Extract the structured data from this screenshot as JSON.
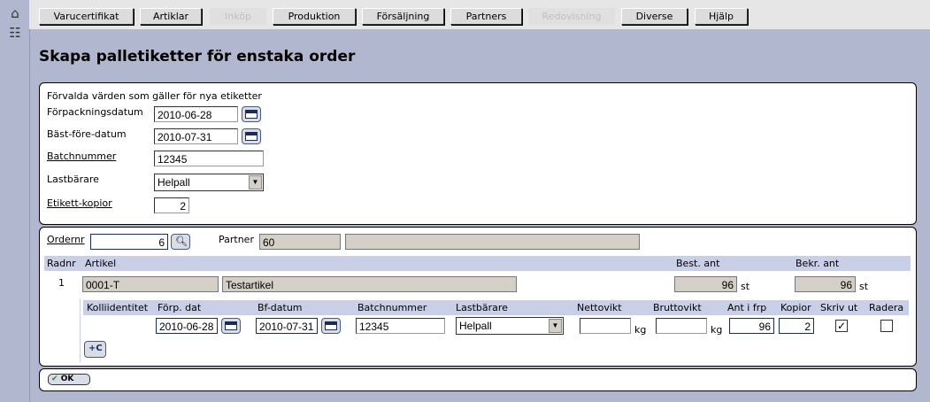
{
  "nav": {
    "menu": [
      "Varucertifikat",
      "Artiklar",
      "Inköp",
      "Produktion",
      "Försäljning",
      "Partners",
      "Redovisning",
      "Diverse",
      "Hjälp"
    ]
  },
  "page": {
    "title": "Skapa palletiketter för enstaka order"
  },
  "defaults": {
    "heading": "Förvalda värden som gäller för nya etiketter",
    "packing_date_label": "Förpackningsdatum",
    "packing_date": "2010-06-28",
    "best_before_label": "Bäst-före-datum",
    "best_before": "2010-07-31",
    "batch_label": "Batchnummer",
    "batch": "12345",
    "carrier_label": "Lastbärare",
    "carrier": "Helpall",
    "copies_label": "Etikett-kopior",
    "copies": "2"
  },
  "order": {
    "order_label": "Ordernr",
    "order_no": "6",
    "partner_label": "Partner",
    "partner_id": "60",
    "partner_name": ""
  },
  "rows_header": {
    "radnr": "Radnr",
    "artikel": "Artikel",
    "best": "Best. ant",
    "bekr": "Bekr. ant"
  },
  "row": {
    "radnr": "1",
    "article_code": "0001-T",
    "article_name": "Testartikel",
    "best_qty": "96",
    "best_unit": "st",
    "bekr_qty": "96",
    "bekr_unit": "st"
  },
  "label_header": {
    "kolli": "Kolliidentitet",
    "forp": "Förp. dat",
    "bf": "Bf-datum",
    "batch": "Batchnummer",
    "last": "Lastbärare",
    "netto": "Nettovikt",
    "brutto": "Bruttovikt",
    "antfrp": "Ant i frp",
    "kopior": "Kopior",
    "skriv": "Skriv ut",
    "radera": "Radera"
  },
  "label_row": {
    "forp": "2010-06-28",
    "bf": "2010-07-31",
    "batch": "12345",
    "last": "Helpall",
    "netto": "",
    "netto_unit": "kg",
    "brutto": "",
    "brutto_unit": "kg",
    "antfrp": "96",
    "kopior": "2",
    "skriv_checked": "✓",
    "radera_checked": ""
  },
  "add_button": "+C",
  "ok_button": "OK",
  "icons": {
    "home": "home-icon",
    "list": "list-icon"
  }
}
